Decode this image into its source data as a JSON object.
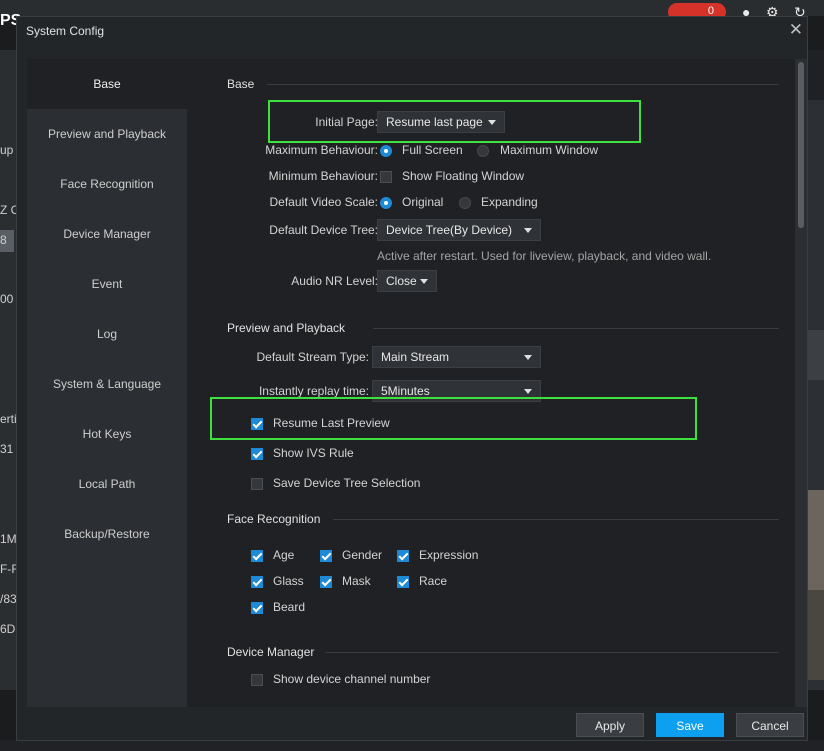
{
  "background": {
    "logo": "PS",
    "record_count": "0",
    "left_fragments": [
      "up",
      "Z C",
      "8",
      "00",
      "erti",
      "31",
      "1M",
      "F-F",
      "/83",
      "6D"
    ]
  },
  "dialog": {
    "title": "System Config",
    "close_glyph": "✕"
  },
  "nav": {
    "items": [
      {
        "label": "Base",
        "active": true
      },
      {
        "label": "Preview and Playback"
      },
      {
        "label": "Face Recognition"
      },
      {
        "label": "Device Manager"
      },
      {
        "label": "Event"
      },
      {
        "label": "Log"
      },
      {
        "label": "System & Language"
      },
      {
        "label": "Hot Keys"
      },
      {
        "label": "Local Path"
      },
      {
        "label": "Backup/Restore"
      }
    ]
  },
  "base": {
    "heading": "Base",
    "initial_page_label": "Initial Page:",
    "initial_page_value": "Resume last page",
    "max_behaviour_label": "Maximum Behaviour:",
    "max_option_1": "Full Screen",
    "max_option_2": "Maximum Window",
    "min_behaviour_label": "Minimum Behaviour:",
    "min_option": "Show Floating Window",
    "video_scale_label": "Default Video Scale:",
    "scale_option_1": "Original",
    "scale_option_2": "Expanding",
    "device_tree_label": "Default Device Tree:",
    "device_tree_value": "Device Tree(By Device)",
    "device_tree_hint": "Active after restart. Used for liveview, playback, and video wall.",
    "audio_nr_label": "Audio NR Level:",
    "audio_nr_value": "Close"
  },
  "preview": {
    "heading": "Preview and Playback",
    "stream_type_label": "Default Stream Type:",
    "stream_type_value": "Main Stream",
    "replay_label": "Instantly replay time:",
    "replay_value": "5Minutes",
    "resume_last_preview": "Resume Last Preview",
    "show_ivs_rule": "Show IVS Rule",
    "save_tree_selection": "Save Device Tree Selection"
  },
  "face": {
    "heading": "Face Recognition",
    "age": "Age",
    "gender": "Gender",
    "expression": "Expression",
    "glass": "Glass",
    "mask": "Mask",
    "race": "Race",
    "beard": "Beard"
  },
  "device_manager": {
    "heading": "Device Manager",
    "show_channel_number": "Show device channel number"
  },
  "buttons": {
    "apply": "Apply",
    "save": "Save",
    "cancel": "Cancel"
  },
  "colors": {
    "accent": "#1e8ad6",
    "highlight": "#3ee03e",
    "save_button": "#0ea0f0"
  }
}
